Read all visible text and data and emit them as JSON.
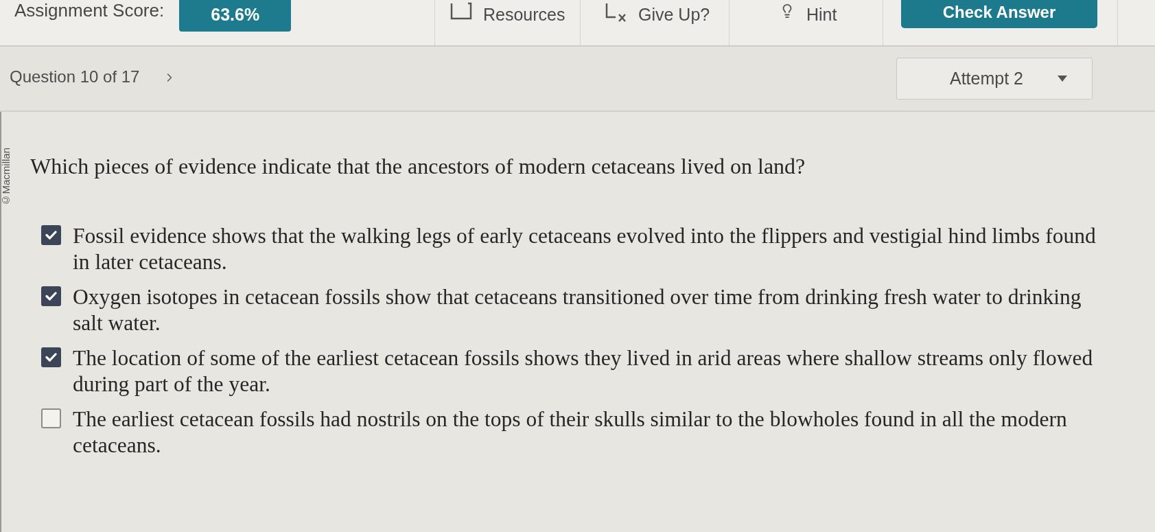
{
  "header": {
    "score_label": "Assignment Score:",
    "score": "63.6%",
    "tools": [
      {
        "kind": "resources",
        "label": "Resources"
      },
      {
        "kind": "give_up",
        "label": "Give Up?"
      },
      {
        "kind": "hint",
        "label": "Hint"
      }
    ],
    "check_button": "Check Answer"
  },
  "nav": {
    "question": "Question 10 of 17",
    "attempt": "Attempt 2"
  },
  "copyright": "©Macmillan",
  "question": {
    "prompt": "Which pieces of evidence indicate that the ancestors of modern cetaceans lived on land?",
    "options": [
      {
        "text": "Fossil evidence shows that the walking legs of early cetaceans evolved into the flippers and vestigial hind limbs found in later cetaceans.",
        "checked": true
      },
      {
        "text": "Oxygen isotopes in cetacean fossils show that cetaceans transitioned over time from drinking fresh water to drinking salt water.",
        "checked": true
      },
      {
        "text": "The location of some of the earliest cetacean fossils shows they lived in arid areas where shallow streams only flowed during part of the year.",
        "checked": true
      },
      {
        "text": "The earliest cetacean fossils had nostrils on the tops of their skulls similar to the blowholes found in all the modern cetaceans.",
        "checked": false
      }
    ]
  }
}
